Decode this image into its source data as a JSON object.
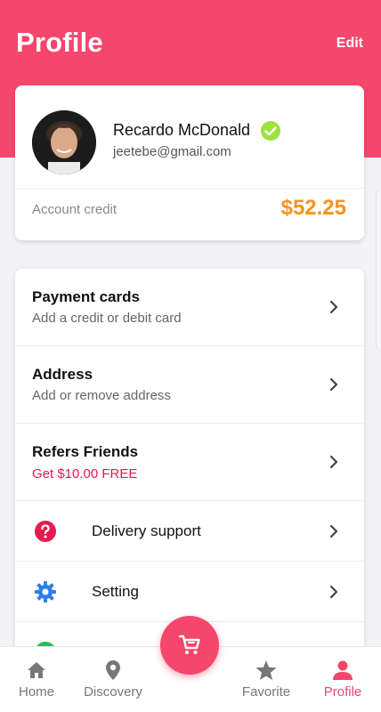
{
  "header": {
    "title": "Profile",
    "edit_label": "Edit"
  },
  "profile": {
    "name": "Recardo McDonald",
    "email": "jeetebe@gmail.com",
    "credit_label": "Account credit",
    "credit_value": "$52.25"
  },
  "menu": [
    {
      "title": "Payment cards",
      "subtitle": "Add a credit or debit card"
    },
    {
      "title": "Address",
      "subtitle": "Add or remove address"
    },
    {
      "title": "Refers Friends",
      "subtitle": "Get $10.00 FREE"
    },
    {
      "label": "Delivery support",
      "icon": "question-circle-icon"
    },
    {
      "label": "Setting",
      "icon": "gear-icon"
    }
  ],
  "bottom_nav": {
    "items": [
      {
        "label": "Home",
        "icon": "home-icon"
      },
      {
        "label": "Discovery",
        "icon": "location-pin-icon"
      },
      {
        "label": "Favorite",
        "icon": "star-icon"
      },
      {
        "label": "Profile",
        "icon": "person-icon"
      }
    ],
    "active": "Profile",
    "fab_icon": "cart-icon"
  },
  "colors": {
    "accent": "#f4476b",
    "credit": "#f7921e",
    "verified": "#9be23a",
    "setting_icon": "#2f7ee6"
  }
}
